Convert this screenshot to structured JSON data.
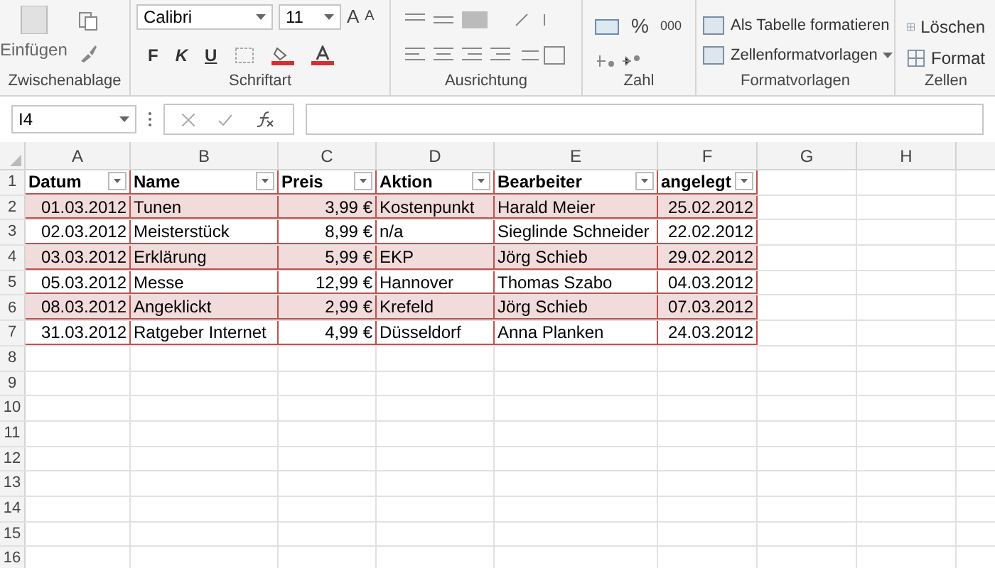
{
  "ribbon": {
    "groups": [
      {
        "kind": "clipboard",
        "label": "Zwischenablage",
        "paste": "Einfügen"
      },
      {
        "kind": "font",
        "label": "Schriftart",
        "font": "Calibri",
        "size": "11",
        "grow": "A",
        "shrink": "A",
        "bold": "F",
        "italic": "K",
        "underline": "U"
      },
      {
        "kind": "alignment",
        "label": "Ausrichtung"
      },
      {
        "kind": "number",
        "label": "Zahl",
        "percent": "%",
        "thousands": "000"
      },
      {
        "kind": "styles",
        "label": "Formatvorlagen",
        "items": [
          "Als Tabelle formatieren",
          "Zellenformatvorlagen"
        ]
      },
      {
        "kind": "cells",
        "label": "Zellen",
        "items": [
          "Löschen",
          "Format"
        ]
      }
    ]
  },
  "name_box": "I4",
  "columns": [
    "A",
    "B",
    "C",
    "D",
    "E",
    "F",
    "G",
    "H"
  ],
  "table": {
    "headers": [
      "Datum",
      "Name",
      "Preis",
      "Aktion",
      "Bearbeiter",
      "angelegt"
    ],
    "rows": [
      {
        "shaded": true,
        "cells": [
          "01.03.2012",
          "Tunen",
          "3,99 €",
          "Kostenpunkt",
          "Harald Meier",
          "25.02.2012"
        ]
      },
      {
        "shaded": false,
        "cells": [
          "02.03.2012",
          "Meisterstück",
          "8,99 €",
          "n/a",
          "Sieglinde Schneider",
          "22.02.2012"
        ]
      },
      {
        "shaded": true,
        "cells": [
          "03.03.2012",
          "Erklärung",
          "5,99 €",
          "EKP",
          "Jörg Schieb",
          "29.02.2012"
        ]
      },
      {
        "shaded": false,
        "cells": [
          "05.03.2012",
          "Messe",
          "12,99 €",
          "Hannover",
          "Thomas Szabo",
          "04.03.2012"
        ]
      },
      {
        "shaded": true,
        "cells": [
          "08.03.2012",
          "Angeklickt",
          "2,99 €",
          "Krefeld",
          "Jörg Schieb",
          "07.03.2012"
        ]
      },
      {
        "shaded": false,
        "cells": [
          "31.03.2012",
          "Ratgeber Internet",
          "4,99 €",
          "Düsseldorf",
          "Anna Planken",
          "24.03.2012"
        ]
      }
    ]
  },
  "row_numbers": [
    "1",
    "2",
    "3",
    "4",
    "5",
    "6",
    "7",
    "8",
    "9",
    "10",
    "11",
    "12",
    "13",
    "14",
    "15",
    "16"
  ]
}
